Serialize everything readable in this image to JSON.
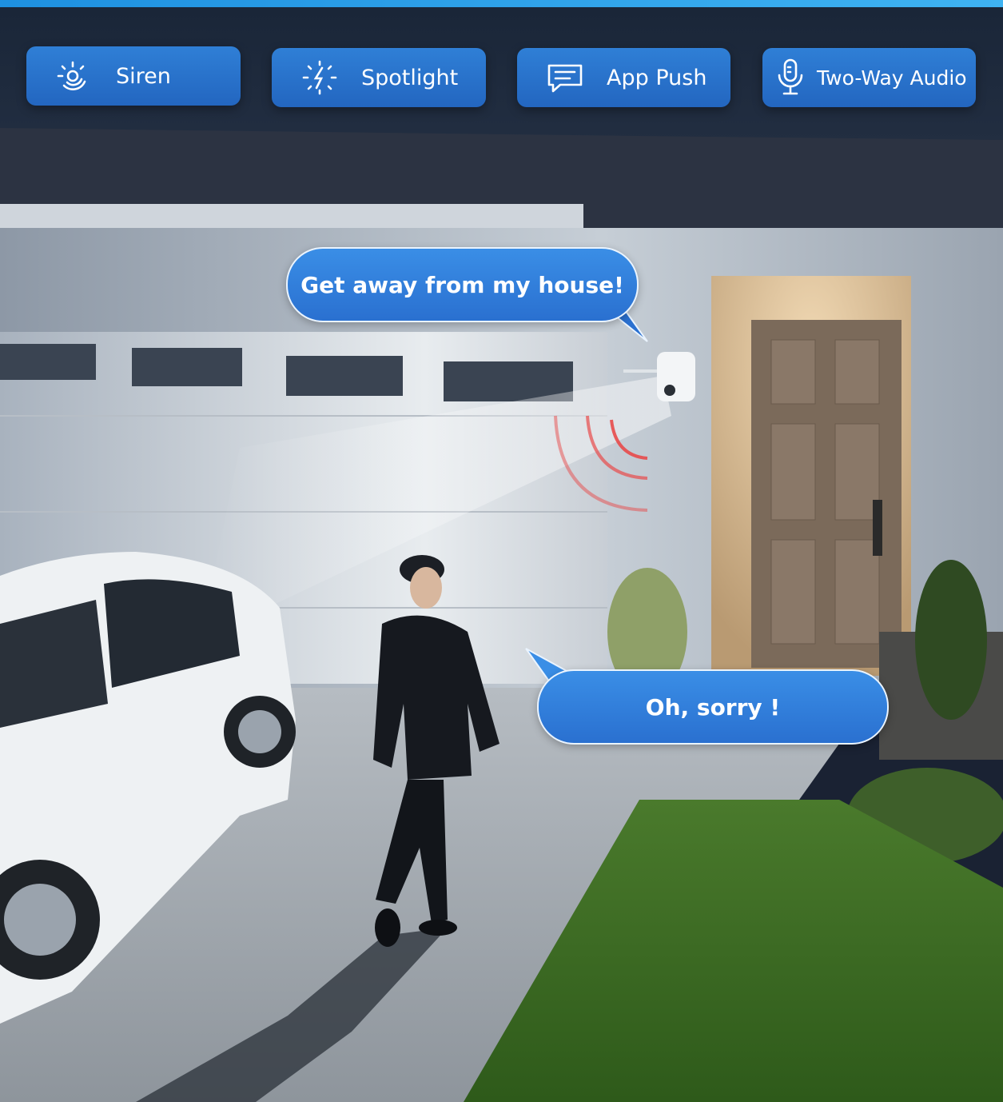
{
  "features": [
    {
      "label": "Siren",
      "icon": "siren-icon"
    },
    {
      "label": "Spotlight",
      "icon": "spotlight-icon"
    },
    {
      "label": "App Push",
      "icon": "chat-message-icon"
    },
    {
      "label": "Two-Way Audio",
      "icon": "microphone-icon"
    }
  ],
  "speech": {
    "camera_message": "Get away from my house!",
    "person_reply": "Oh, sorry !"
  },
  "colors": {
    "accent_blue": "#2a70d0",
    "top_bar": "#1e90e0",
    "sound_wave": "#e84a4a"
  }
}
